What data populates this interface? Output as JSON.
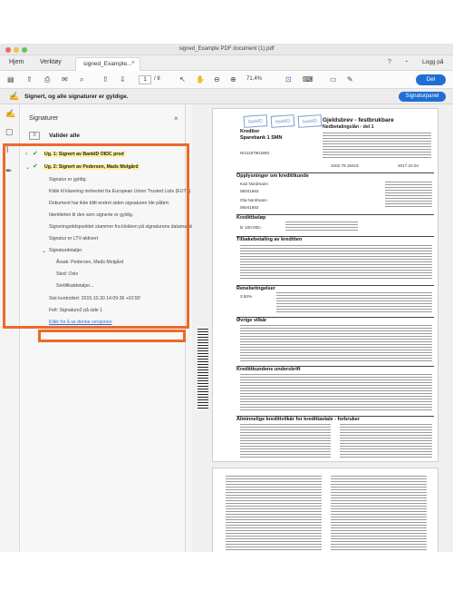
{
  "window": {
    "title": "signed_Example PDF document (1).pdf"
  },
  "tabs": {
    "home": "Hjem",
    "tools": "Verktøy",
    "document_tab": "signed_Example...",
    "signin": "Logg på"
  },
  "toolbar": {
    "page_current": "1",
    "page_total": "/ 8",
    "zoom": "71,4%",
    "share_label": "Del"
  },
  "signature_bar": {
    "status": "Signert, og alle signaturer er gyldige.",
    "panel_button": "Signaturpanel"
  },
  "signature_panel": {
    "title": "Signaturer",
    "validate_all": "Valider alle",
    "sig1": "Ug. 1: Signert av BankID OIDC prod",
    "sig2": "Ug. 2: Signert av Pedersen, Mads Molgård",
    "details": [
      "Signatur er gyldig:",
      "Kilde til klarering innhentet fra European Union Trusted Lists (EUTL).",
      "Dokument har ikke blitt endret siden signaturen ble påført.",
      "Identiteten til den som signerte er gyldig.",
      "Signeringstidspunktet stammer fra klokken på signaturens datamaskin.",
      "Signatur er LTV-aktivert"
    ],
    "details_header": "Signaturdetaljer",
    "reason": "Årsak: Pedersen, Mads Molgård",
    "location": "Sted: Oslo",
    "certificate": "Sertifikatdetaljer...",
    "last_checked": "Sist kontrollert: 2015.10.30 14:09:36 +01'00'",
    "field": "Felt: Signature2 på side 1",
    "link": "Klikk for å se denne versjonen"
  },
  "document": {
    "stamp1": "bankID",
    "stamp2": "bankID",
    "stamp3": "bankID",
    "form_label": "Kreditor",
    "bank_name": "Sparebank 1 SMN",
    "title": "Gjeldsbrev - festbrukbare",
    "subtitle": "Nedbetalingslån - del 1",
    "sections": [
      "Opplysninger om kredittkunde",
      "Kredittbeløp",
      "Tilbakebetaling av kreditten",
      "Renebetingelser",
      "Øvrige vilkår",
      "Kredittkundens underskrift",
      "Alminnelige kredittvilkår for kredittavtale - forbruker"
    ],
    "fields": {
      "org_no": "NO1187901893",
      "customer1": "Kari Nordmann",
      "customer1_id": "06041563",
      "customer2": "Ola Nordmann",
      "customer2_id": "06041563",
      "amount": "kr 100.000,-",
      "rate": "3.50%",
      "account": "4202.79.19419",
      "date": "2017.10.04"
    }
  },
  "colors": {
    "accent": "#1f6ed4",
    "valid_green": "#2e9e3b",
    "annotation_orange": "#ec6a2a"
  },
  "icons": {
    "close": "close-icon",
    "check": "check-icon",
    "chevron": "chevron-icon"
  }
}
